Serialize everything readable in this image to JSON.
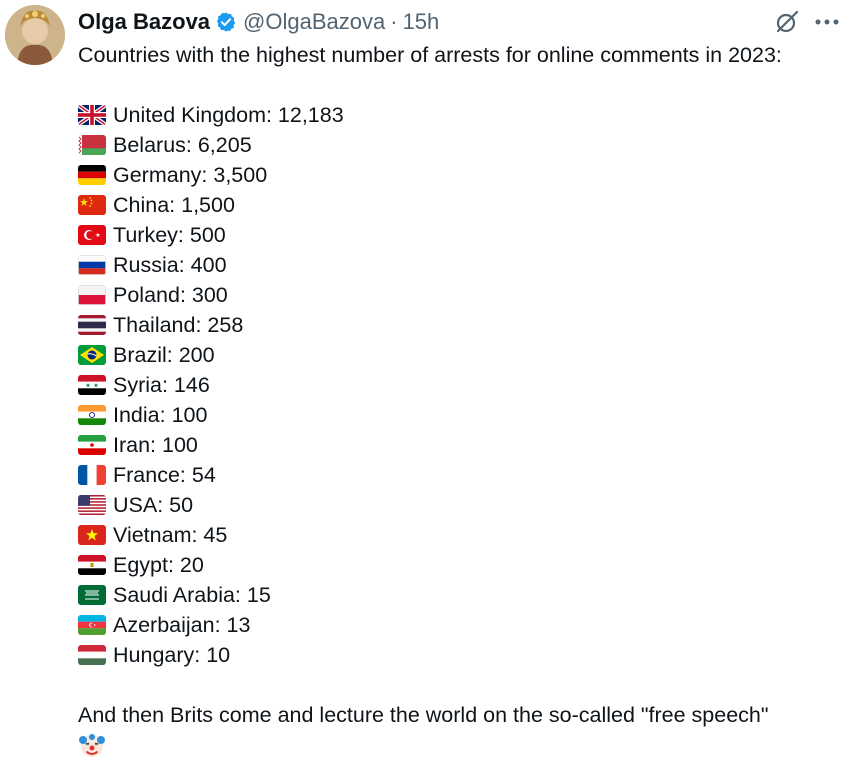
{
  "post": {
    "author_name": "Olga Bazova",
    "handle": "@OlgaBazova",
    "separator": "·",
    "time": "15h",
    "intro": "Countries with the highest number of arrests for online comments in 2023:",
    "list": [
      {
        "flag": "uk-flag-icon",
        "text": "United Kingdom: 12,183"
      },
      {
        "flag": "belarus-flag-icon",
        "text": "Belarus: 6,205"
      },
      {
        "flag": "germany-flag-icon",
        "text": "Germany: 3,500"
      },
      {
        "flag": "china-flag-icon",
        "text": "China: 1,500"
      },
      {
        "flag": "turkey-flag-icon",
        "text": "Turkey: 500"
      },
      {
        "flag": "russia-flag-icon",
        "text": "Russia: 400"
      },
      {
        "flag": "poland-flag-icon",
        "text": "Poland: 300"
      },
      {
        "flag": "thailand-flag-icon",
        "text": "Thailand: 258"
      },
      {
        "flag": "brazil-flag-icon",
        "text": "Brazil: 200"
      },
      {
        "flag": "syria-flag-icon",
        "text": "Syria: 146"
      },
      {
        "flag": "india-flag-icon",
        "text": "India: 100"
      },
      {
        "flag": "iran-flag-icon",
        "text": "Iran: 100"
      },
      {
        "flag": "france-flag-icon",
        "text": "France: 54"
      },
      {
        "flag": "usa-flag-icon",
        "text": "USA: 50"
      },
      {
        "flag": "vietnam-flag-icon",
        "text": "Vietnam: 45"
      },
      {
        "flag": "egypt-flag-icon",
        "text": "Egypt: 20"
      },
      {
        "flag": "saudi-arabia-flag-icon",
        "text": "Saudi Arabia: 15"
      },
      {
        "flag": "azerbaijan-flag-icon",
        "text": "Azerbaijan: 13"
      },
      {
        "flag": "hungary-flag-icon",
        "text": "Hungary: 10"
      }
    ],
    "outro": "And then Brits come and lecture the world on the so-called \"free speech\"",
    "outro_emoji": "clown-face-icon"
  },
  "colors": {
    "text": "#0f1419",
    "secondary": "#536471",
    "verified_blue": "#1d9bf0"
  }
}
